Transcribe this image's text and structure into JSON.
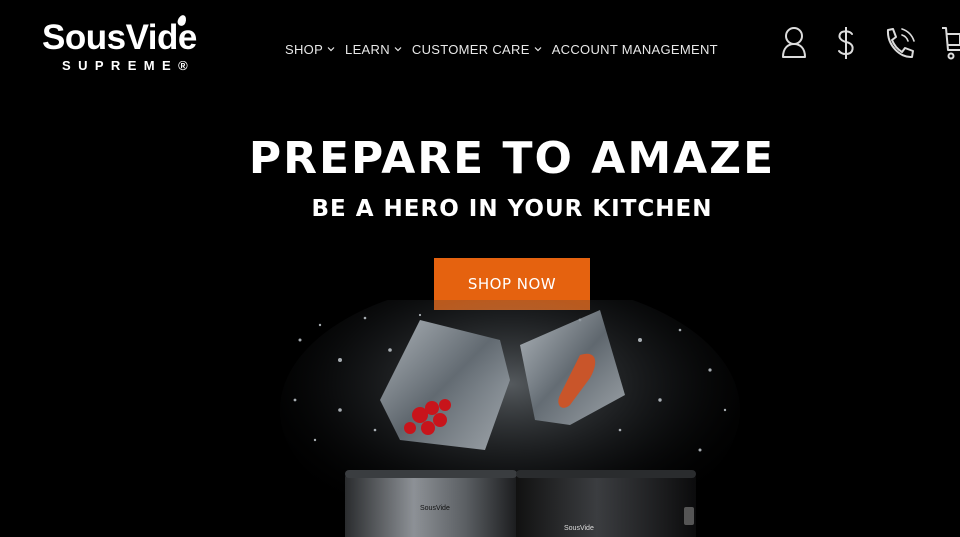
{
  "header": {
    "logo": {
      "word": "SousVide",
      "sub": "SUPREME®"
    },
    "nav": [
      {
        "label": "SHOP",
        "has_dropdown": true
      },
      {
        "label": "LEARN",
        "has_dropdown": true
      },
      {
        "label": "CUSTOMER CARE",
        "has_dropdown": true
      },
      {
        "label": "ACCOUNT MANAGEMENT",
        "has_dropdown": false
      }
    ],
    "icons": [
      "user-icon",
      "dollar-icon",
      "phone-icon",
      "cart-icon"
    ]
  },
  "hero": {
    "title": "PREPARE TO AMAZE",
    "subtitle": "BE A HERO IN YOUR KITCHEN",
    "cta_label": "SHOP NOW",
    "device_left_label": "SousVide",
    "device_right_label": "SousVide"
  },
  "colors": {
    "background": "#000000",
    "accent": "#e5620f",
    "text": "#ffffff"
  }
}
